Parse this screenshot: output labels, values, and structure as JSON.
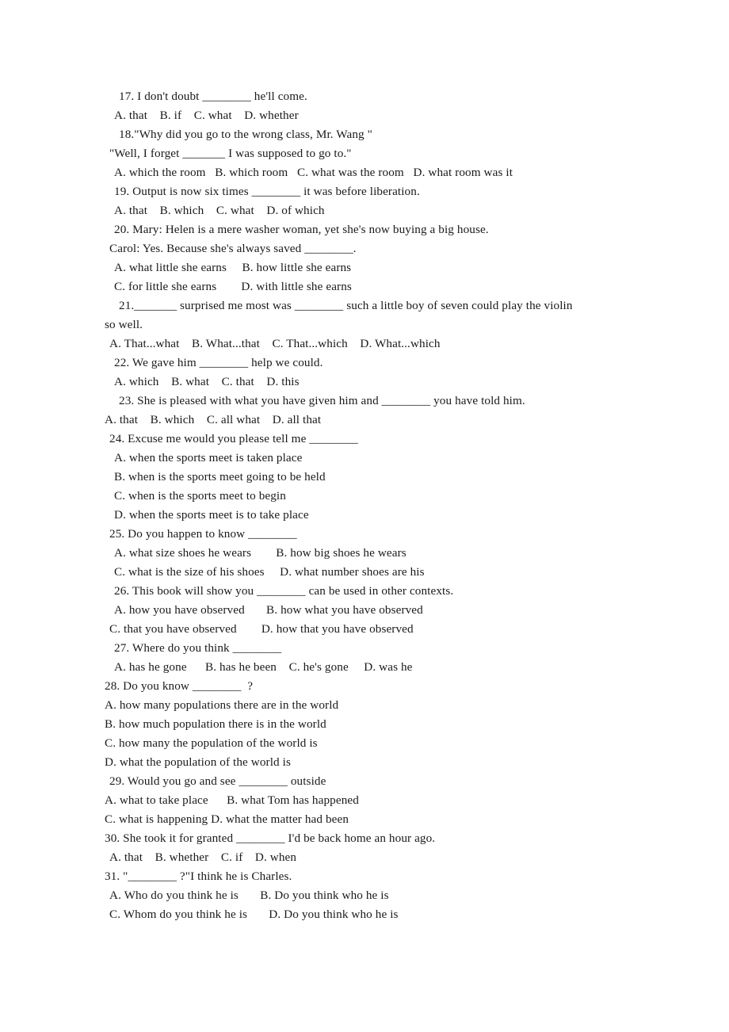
{
  "document": {
    "type": "grammar-worksheet",
    "page_background": "#ffffff",
    "text_color": "#1a1a1a",
    "blank_marker": "________",
    "lines": [
      {
        "id": "q17-stem",
        "indent": 3,
        "text": "17. I don't doubt ________ he'll come."
      },
      {
        "id": "q17-opts",
        "indent": 2,
        "text": "A. that    B. if    C. what    D. whether"
      },
      {
        "id": "q18-stem",
        "indent": 3,
        "text": "18.\"Why did you go to the wrong class, Mr. Wang \""
      },
      {
        "id": "q18-stem2",
        "indent": 1,
        "text": "\"Well, I forget _______ I was supposed to go to.\""
      },
      {
        "id": "q18-opts",
        "indent": 2,
        "text": "A. which the room   B. which room   C. what was the room   D. what room was it"
      },
      {
        "id": "q19-stem",
        "indent": 2,
        "text": "19. Output is now six times ________ it was before liberation."
      },
      {
        "id": "q19-opts",
        "indent": 2,
        "text": "A. that    B. which    C. what    D. of which"
      },
      {
        "id": "q20-stem",
        "indent": 2,
        "text": "20. Mary: Helen is a mere washer woman, yet she's now buying a big house."
      },
      {
        "id": "q20-stem2",
        "indent": 1,
        "text": "Carol: Yes. Because she's always saved ________."
      },
      {
        "id": "q20-optsAB",
        "indent": 2,
        "text": "A. what little she earns     B. how little she earns"
      },
      {
        "id": "q20-optsCD",
        "indent": 2,
        "text": "C. for little she earns        D. with little she earns"
      },
      {
        "id": "q21-stem",
        "indent": 3,
        "text": "21._______ surprised me most was ________ such a little boy of seven could play the violin"
      },
      {
        "id": "q21-stem2",
        "indent": 0,
        "text": "so well."
      },
      {
        "id": "q21-opts",
        "indent": 1,
        "text": "A. That...what    B. What...that    C. That...which    D. What...which"
      },
      {
        "id": "q22-stem",
        "indent": 2,
        "text": "22. We gave him ________ help we could."
      },
      {
        "id": "q22-opts",
        "indent": 2,
        "text": "A. which    B. what    C. that    D. this"
      },
      {
        "id": "q23-stem",
        "indent": 3,
        "text": "23. She is pleased with what you have given him and ________ you have told him."
      },
      {
        "id": "q23-opts",
        "indent": 0,
        "text": "A. that    B. which    C. all what    D. all that"
      },
      {
        "id": "q24-stem",
        "indent": 1,
        "text": "24. Excuse me would you please tell me ________"
      },
      {
        "id": "q24-optA",
        "indent": 2,
        "text": "A. when the sports meet is taken place"
      },
      {
        "id": "q24-optB",
        "indent": 2,
        "text": "B. when is the sports meet going to be held"
      },
      {
        "id": "q24-optC",
        "indent": 2,
        "text": "C. when is the sports meet to begin"
      },
      {
        "id": "q24-optD",
        "indent": 2,
        "text": "D. when the sports meet is to take place"
      },
      {
        "id": "q25-stem",
        "indent": 1,
        "text": "25. Do you happen to know ________"
      },
      {
        "id": "q25-optsAB",
        "indent": 2,
        "text": "A. what size shoes he wears        B. how big shoes he wears"
      },
      {
        "id": "q25-optsCD",
        "indent": 2,
        "text": "C. what is the size of his shoes     D. what number shoes are his"
      },
      {
        "id": "q26-stem",
        "indent": 2,
        "text": "26. This book will show you ________ can be used in other contexts."
      },
      {
        "id": "q26-optsAB",
        "indent": 2,
        "text": "A. how you have observed       B. how what you have observed"
      },
      {
        "id": "q26-optsCD",
        "indent": 1,
        "text": "C. that you have observed        D. how that you have observed"
      },
      {
        "id": "q27-stem",
        "indent": 2,
        "text": "27. Where do you think ________"
      },
      {
        "id": "q27-opts",
        "indent": 2,
        "text": "A. has he gone      B. has he been    C. he's gone     D. was he"
      },
      {
        "id": "q28-stem",
        "indent": 0,
        "text": "28. Do you know ________  ?"
      },
      {
        "id": "q28-optA",
        "indent": 0,
        "text": "A. how many populations there are in the world"
      },
      {
        "id": "q28-optB",
        "indent": 0,
        "text": "B. how much population there is in the world"
      },
      {
        "id": "q28-optC",
        "indent": 0,
        "text": "C. how many the population of the world is"
      },
      {
        "id": "q28-optD",
        "indent": 0,
        "text": "D. what the population of the world is"
      },
      {
        "id": "q29-stem",
        "indent": 1,
        "text": "29. Would you go and see ________ outside"
      },
      {
        "id": "q29-optsAB",
        "indent": 0,
        "text": "A. what to take place      B. what Tom has happened"
      },
      {
        "id": "q29-optsCD",
        "indent": 0,
        "text": "C. what is happening D. what the matter had been"
      },
      {
        "id": "q30-stem",
        "indent": 0,
        "text": "30. She took it for granted ________ I'd be back home an hour ago."
      },
      {
        "id": "q30-opts",
        "indent": 1,
        "text": "A. that    B. whether    C. if    D. when"
      },
      {
        "id": "q31-stem",
        "indent": 0,
        "text": "31. \"________ ?\"I think he is Charles."
      },
      {
        "id": "q31-optsAB",
        "indent": 1,
        "text": "A. Who do you think he is       B. Do you think who he is"
      },
      {
        "id": "q31-optsCD",
        "indent": 1,
        "text": "C. Whom do you think he is       D. Do you think who he is"
      }
    ]
  }
}
